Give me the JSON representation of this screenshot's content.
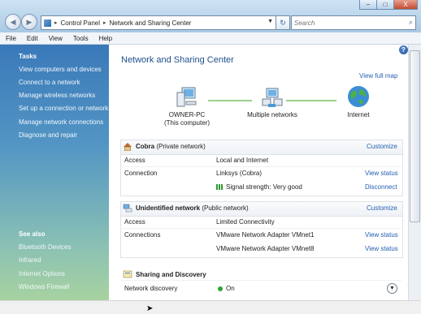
{
  "window": {
    "min": "–",
    "max": "□",
    "close": "X"
  },
  "address": {
    "root_icon": "control-panel-icon",
    "crumbs": [
      "Control Panel",
      "Network and Sharing Center"
    ],
    "search_placeholder": "Search"
  },
  "menu": [
    "File",
    "Edit",
    "View",
    "Tools",
    "Help"
  ],
  "sidebar": {
    "tasks_title": "Tasks",
    "tasks": [
      "View computers and devices",
      "Connect to a network",
      "Manage wireless networks",
      "Set up a connection or network",
      "Manage network connections",
      "Diagnose and repair"
    ],
    "seealso_title": "See also",
    "seealso": [
      "Bluetooth Devices",
      "Infrared",
      "Internet Options",
      "Windows Firewall"
    ]
  },
  "main": {
    "title": "Network and Sharing Center",
    "view_full_map": "View full map",
    "map": {
      "pc_line1": "OWNER-PC",
      "pc_line2": "(This computer)",
      "networks": "Multiple networks",
      "internet": "Internet"
    },
    "cobra": {
      "name": "Cobra",
      "type": "(Private network)",
      "customize": "Customize",
      "access_label": "Access",
      "access_value": "Local and Internet",
      "connection_label": "Connection",
      "connection_value": "Linksys (Cobra)",
      "view_status": "View status",
      "signal": "Signal strength:  Very good",
      "disconnect": "Disconnect"
    },
    "unidentified": {
      "name": "Unidentified network",
      "type": "(Public network)",
      "customize": "Customize",
      "access_label": "Access",
      "access_value": "Limited Connectivity",
      "connections_label": "Connections",
      "conn1": "VMware Network Adapter VMnet1",
      "conn2": "VMware Network Adapter VMnet8",
      "view_status1": "View status",
      "view_status2": "View status"
    },
    "sharing": {
      "title": "Sharing and Discovery",
      "discovery_label": "Network discovery",
      "discovery_value": "On"
    }
  },
  "colors": {
    "title_blue": "#1e4f8a",
    "link_blue": "#2660b1",
    "sidebar_top": "#3a79b9",
    "sidebar_bottom": "#a7d2a0"
  }
}
